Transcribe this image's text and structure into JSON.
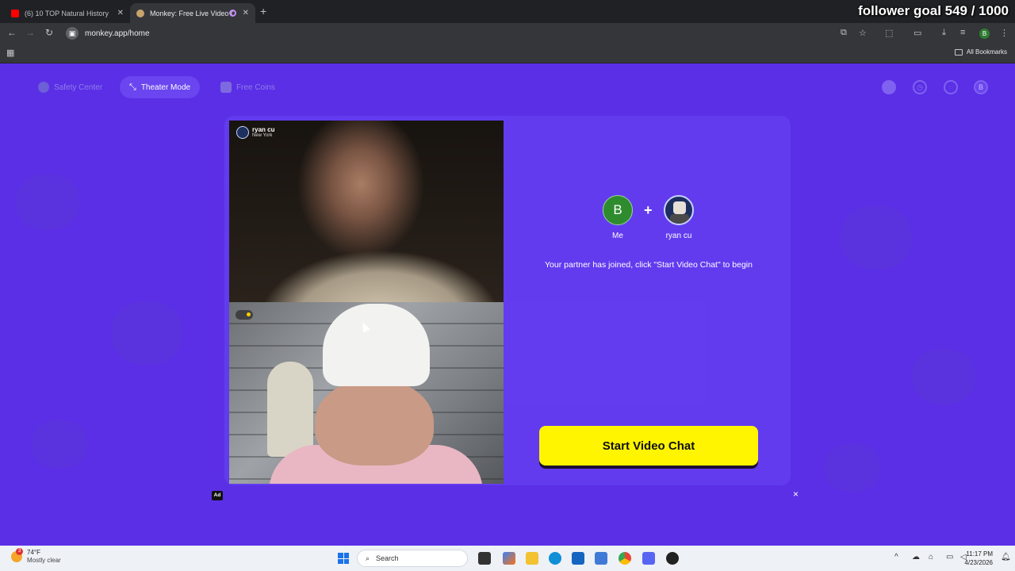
{
  "browser": {
    "tabs": [
      {
        "title": "(6) 10 TOP Natural History Mo",
        "active": false
      },
      {
        "title": "Monkey: Free Live Video Ch",
        "active": true
      }
    ],
    "overlay_text": "follower goal 549 / 1000",
    "url": "monkey.app/home",
    "bookmarks_label": "All Bookmarks",
    "profile_initial": "B"
  },
  "nav": {
    "safety_center": "Safety Center",
    "theater_mode": "Theater Mode",
    "free_coins": "Free Coins",
    "profile_initial": "B"
  },
  "partner": {
    "name": "ryan cu",
    "location": "New York"
  },
  "match": {
    "me_initial": "B",
    "me_label": "Me",
    "plus": "+",
    "partner_label": "ryan cu",
    "status_message": "Your partner has joined, click \"Start Video Chat\" to begin"
  },
  "actions": {
    "start_video_chat": "Start Video Chat",
    "ad_label": "Ad",
    "close": "×"
  },
  "taskbar": {
    "temperature": "74°F",
    "condition": "Mostly clear",
    "weather_badge": "3",
    "search_placeholder": "Search",
    "time": "11:17 PM",
    "date": "4/23/2026"
  },
  "colors": {
    "page_background": "#5b2fe6",
    "start_button": "#fff500",
    "me_avatar": "#2e8b2e"
  }
}
